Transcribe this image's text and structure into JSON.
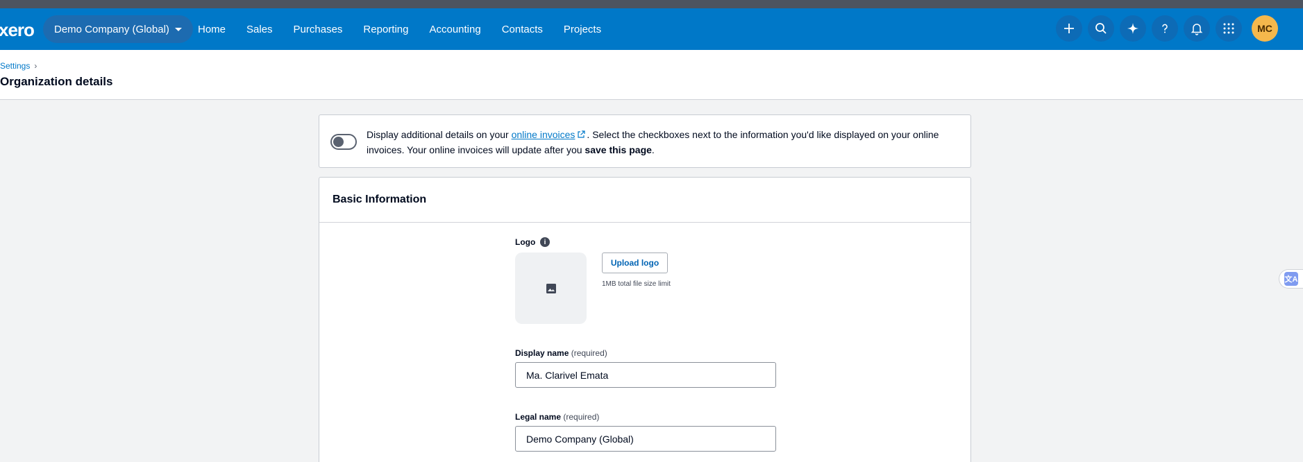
{
  "app": {
    "logo_text": "xero"
  },
  "header": {
    "org_name": "Demo Company (Global)",
    "nav": [
      "Home",
      "Sales",
      "Purchases",
      "Reporting",
      "Accounting",
      "Contacts",
      "Projects"
    ],
    "icons": [
      "plus-icon",
      "search-icon",
      "sparkle-icon",
      "help-icon",
      "bell-icon",
      "apps-grid-icon"
    ],
    "avatar_initials": "MC",
    "colors": {
      "navbar": "#0078c8",
      "avatar": "#f5b84c"
    }
  },
  "breadcrumb": {
    "parent": "Settings",
    "separator": "›"
  },
  "page": {
    "title": "Organization details"
  },
  "notice": {
    "text_before": "Display additional details on your ",
    "link_text": "online invoices",
    "text_after": ". Select the checkboxes next to the information you'd like displayed on your online invoices. Your online invoices will update after you ",
    "bold_text": "save this page",
    "text_end": ".",
    "toggle_on": false
  },
  "basic_info": {
    "title": "Basic Information",
    "logo_label": "Logo",
    "upload_button": "Upload logo",
    "upload_hint": "1MB total file size limit",
    "display_name_label": "Display name",
    "display_name_req": "(required)",
    "display_name_value": "Ma. Clarivel Emata",
    "legal_name_label": "Legal name",
    "legal_name_req": "(required)",
    "legal_name_value": "Demo Company (Global)"
  }
}
